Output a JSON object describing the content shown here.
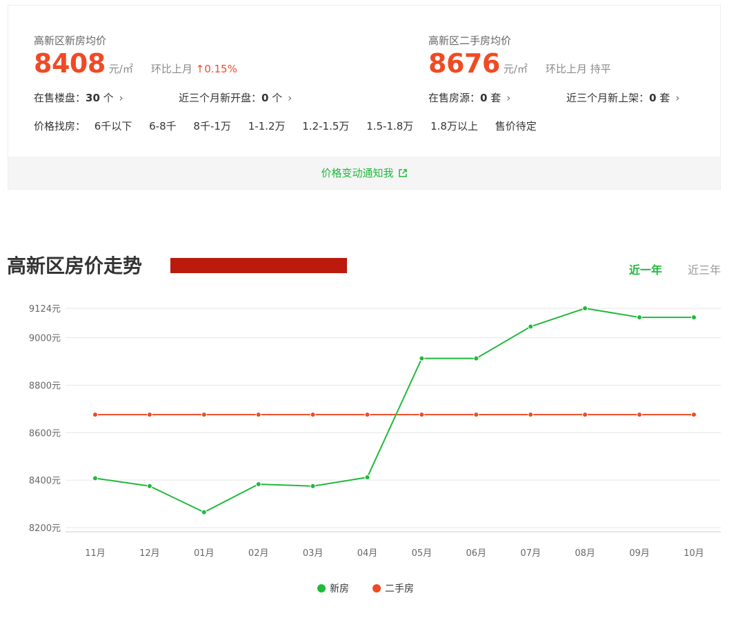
{
  "summary": {
    "new_home": {
      "label": "高新区新房均价",
      "price": "8408",
      "unit": "元/㎡",
      "mom_label": "环比上月",
      "mom_value": "↑0.15%",
      "on_sale_label": "在售楼盘：",
      "on_sale_count": "30",
      "on_sale_unit": " 个",
      "recent_label": "近三个月新开盘：",
      "recent_count": "0",
      "recent_unit": " 个"
    },
    "second_hand": {
      "label": "高新区二手房均价",
      "price": "8676",
      "unit": "元/㎡",
      "mom_label": "环比上月",
      "mom_value": "持平",
      "on_sale_label": "在售房源：",
      "on_sale_count": "0",
      "on_sale_unit": " 套",
      "recent_label": "近三个月新上架：",
      "recent_count": "0",
      "recent_unit": " 套"
    },
    "price_filter_label": "价格找房：",
    "price_filters": [
      "6千以下",
      "6-8千",
      "8千-1万",
      "1-1.2万",
      "1.2-1.5万",
      "1.5-1.8万",
      "1.8万以上",
      "售价待定"
    ],
    "notify_label": "价格变动通知我"
  },
  "trend": {
    "title": "高新区房价走势",
    "tabs": [
      {
        "label": "近一年",
        "active": true
      },
      {
        "label": "近三年",
        "active": false
      }
    ]
  },
  "colors": {
    "accent_green": "#1fb93b",
    "price_red": "#f04a25",
    "redaction": "#bb1a0c"
  },
  "chart_data": {
    "type": "line",
    "categories": [
      "11月",
      "12月",
      "01月",
      "02月",
      "03月",
      "04月",
      "05月",
      "06月",
      "07月",
      "08月",
      "09月",
      "10月"
    ],
    "y_ticks": [
      8200,
      8400,
      8600,
      8800,
      9000,
      9124
    ],
    "y_tick_suffix": "元",
    "ylim": [
      8200,
      9124
    ],
    "series": [
      {
        "name": "新房",
        "color": "#1fb93b",
        "values": [
          8408,
          8375,
          8265,
          8383,
          8375,
          8412,
          8913,
          8913,
          9047,
          9124,
          9086,
          9086
        ]
      },
      {
        "name": "二手房",
        "color": "#f04a25",
        "values": [
          8676,
          8676,
          8676,
          8676,
          8676,
          8676,
          8676,
          8676,
          8676,
          8676,
          8676,
          8676
        ]
      }
    ],
    "grid": true,
    "legend_position": "bottom"
  }
}
